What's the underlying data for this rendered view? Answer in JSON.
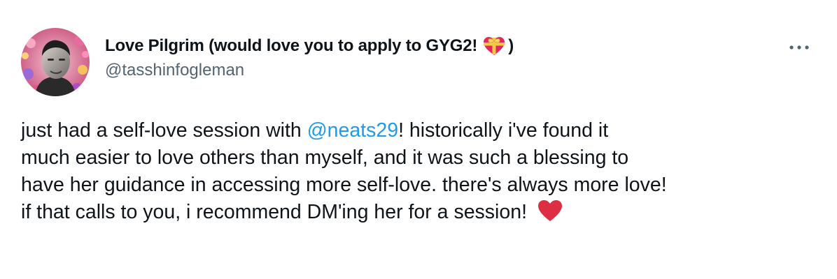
{
  "author": {
    "display_name": "Love Pilgrim (would love you to apply to GYG2! ",
    "display_name_close": ")",
    "name_emoji": "heart-with-ribbon-icon",
    "handle": "@tasshinfogleman"
  },
  "more_options": {
    "icon": "more-horizontal-icon"
  },
  "tweet": {
    "text_before_mention": "just had a self-love session with ",
    "mention": "@neats29",
    "text_after_mention": "! historically i've found it\nmuch easier to love others than myself, and it was such a blessing to\nhave her guidance in accessing more self-love. there's always more love!\nif that calls to you, i recommend DM'ing her for a session! ",
    "trailing_emoji": "red-heart-icon"
  },
  "colors": {
    "text": "#0f1419",
    "secondary": "#536471",
    "link": "#1d9bf0",
    "heart": "#e0245e"
  }
}
